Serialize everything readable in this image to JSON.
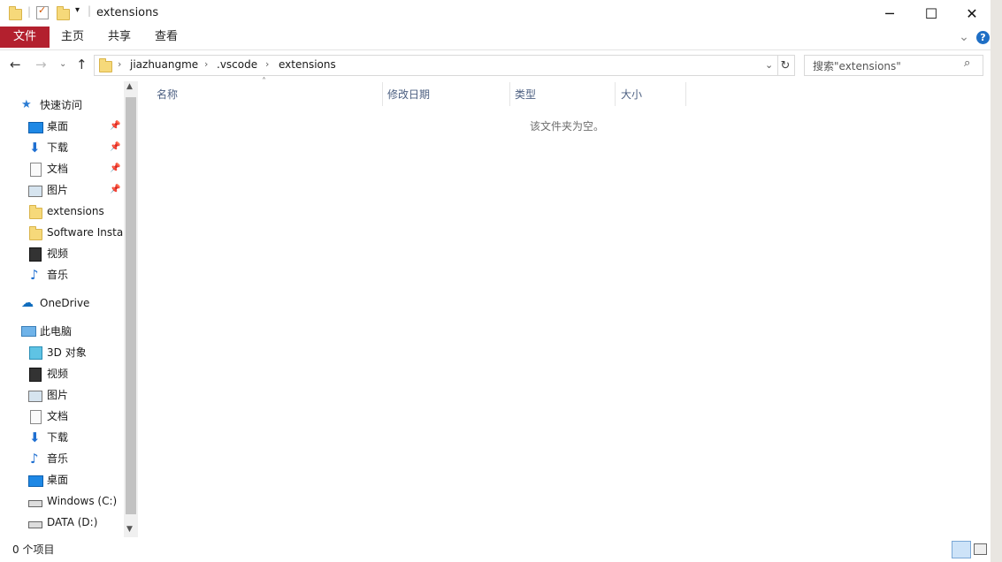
{
  "window": {
    "title": "extensions",
    "controls": {
      "minimize": "─",
      "maximize": "☐",
      "close": "✕"
    }
  },
  "ribbon": {
    "tabs": [
      "文件",
      "主页",
      "共享",
      "查看"
    ],
    "help": "?",
    "expand": "⌄",
    "accent": "#b3202e"
  },
  "address": {
    "crumbs": [
      "jiazhuangme",
      ".vscode",
      "extensions"
    ],
    "search_placeholder": "搜索\"extensions\""
  },
  "nav": {
    "quick_access": "快速访问",
    "quick_items": [
      "桌面",
      "下载",
      "文档",
      "图片",
      "extensions",
      "Software Instal",
      "视频",
      "音乐"
    ],
    "onedrive": "OneDrive",
    "this_pc": "此电脑",
    "pc_items": [
      "3D 对象",
      "视频",
      "图片",
      "文档",
      "下载",
      "音乐",
      "桌面",
      "Windows (C:)",
      "DATA (D:)"
    ]
  },
  "columns": [
    "名称",
    "修改日期",
    "类型",
    "大小"
  ],
  "empty_message": "该文件夹为空。",
  "status": "0 个项目"
}
